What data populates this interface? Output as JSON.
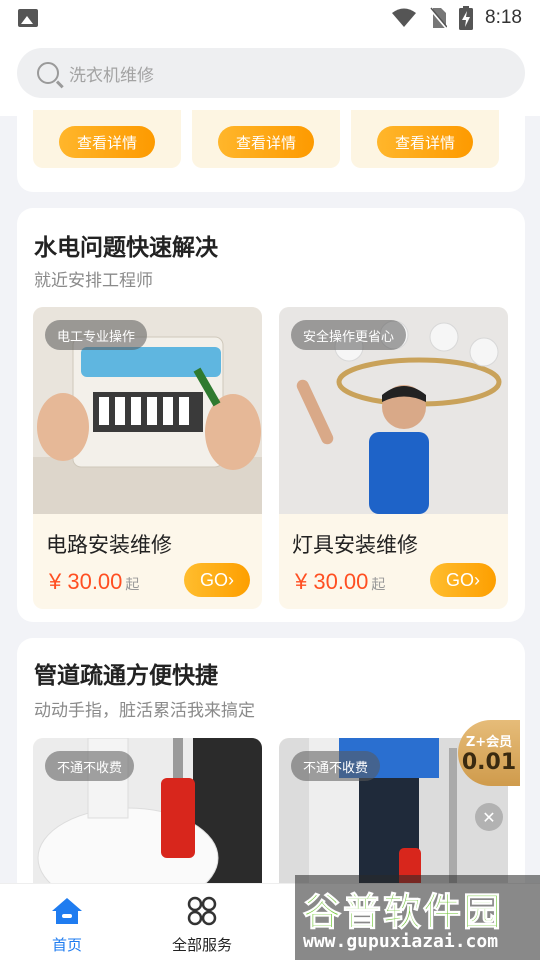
{
  "status_bar": {
    "time": "8:18"
  },
  "search": {
    "placeholder": "洗衣机维修"
  },
  "top_cards": [
    {
      "button": "查看详情"
    },
    {
      "button": "查看详情"
    },
    {
      "button": "查看详情"
    }
  ],
  "section_water_electric": {
    "title": "水电问题快速解决",
    "subtitle": "就近安排工程师",
    "items": [
      {
        "tag": "电工专业操作",
        "name": "电路安装维修",
        "price": "¥ 30.00",
        "price_suffix": "起",
        "go": "GO"
      },
      {
        "tag": "安全操作更省心",
        "name": "灯具安装维修",
        "price": "¥ 30.00",
        "price_suffix": "起",
        "go": "GO"
      }
    ]
  },
  "section_pipe": {
    "title": "管道疏通方便快捷",
    "subtitle": "动动手指，脏活累活我来搞定",
    "items": [
      {
        "tag": "不通不收费"
      },
      {
        "tag": "不通不收费"
      }
    ]
  },
  "member_badge": {
    "line1": "Z+会员",
    "line2": "0.01"
  },
  "bottom_nav": [
    {
      "label": "首页",
      "icon": "home-icon",
      "active": true
    },
    {
      "label": "全部服务",
      "icon": "grid-icon",
      "active": false
    }
  ],
  "watermark": {
    "line1": "谷普软件园",
    "line2": "www.gupuxiazai.com"
  },
  "colors": {
    "accent_orange": "#fd9a00",
    "price_red": "#ff4f22",
    "nav_active": "#1f7cf0"
  }
}
